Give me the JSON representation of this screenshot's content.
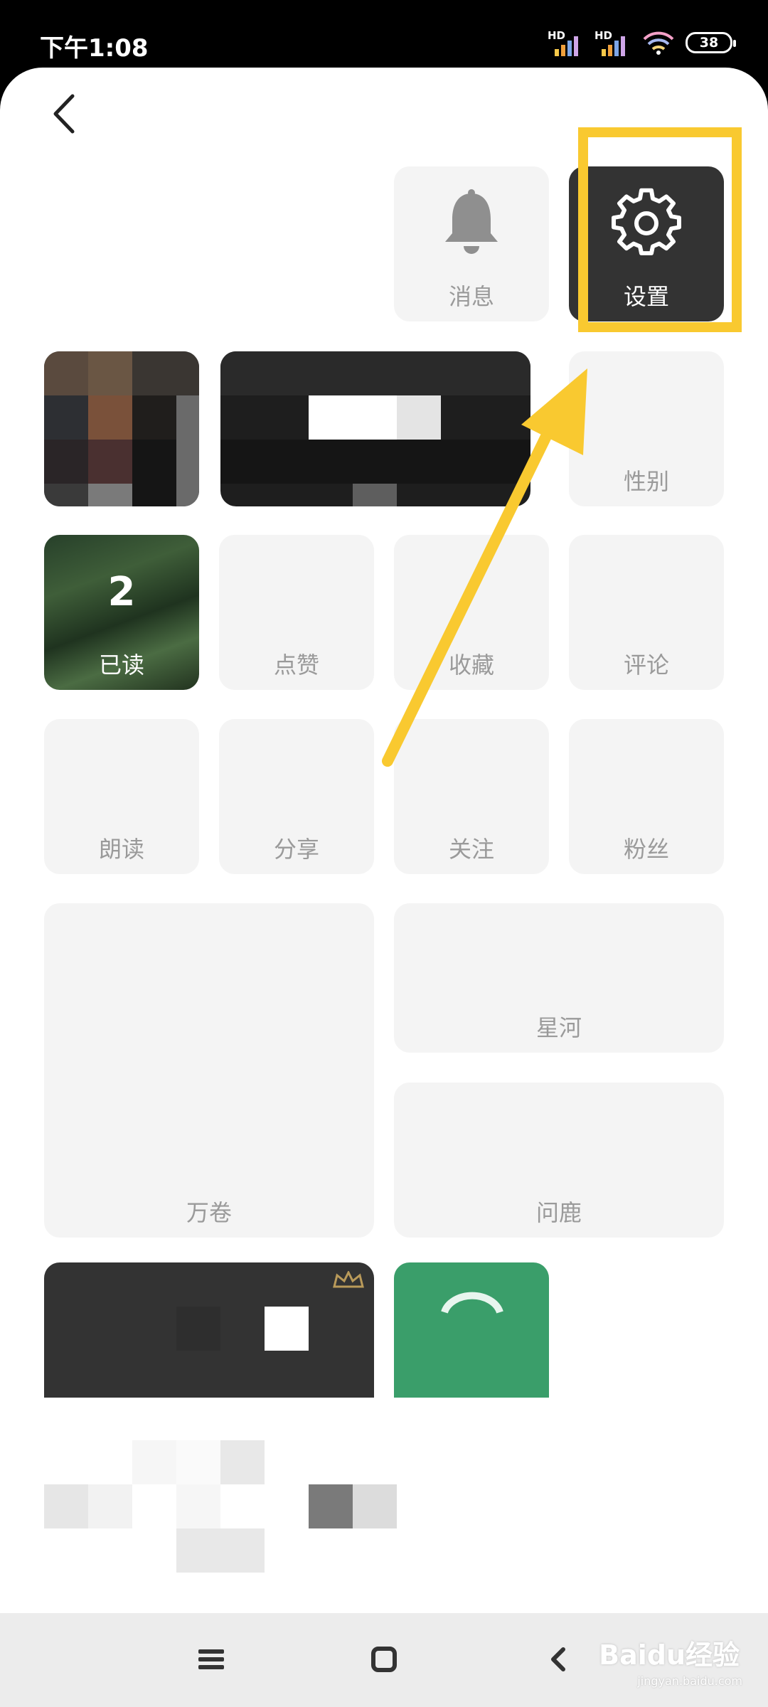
{
  "status_bar": {
    "time": "下午1:08",
    "sim1_label": "HD",
    "sim2_label": "HD",
    "battery": "38"
  },
  "tiles": {
    "messages": "消息",
    "settings": "设置",
    "gender": "性别",
    "read": "已读",
    "read_count": "2",
    "likes": "点赞",
    "favorites": "收藏",
    "comments": "评论",
    "read_aloud": "朗读",
    "share": "分享",
    "follow": "关注",
    "fans": "粉丝",
    "wanjuan": "万卷",
    "xinghe": "星河",
    "wenlu": "问鹿"
  },
  "watermark": {
    "brand": "Baidu经验",
    "url": "jingyan.baidu.com"
  },
  "colors": {
    "highlight": "#f9c930",
    "tile_bg": "#f4f4f4",
    "dark_tile": "#333333",
    "green_tile": "#3a9e6a"
  }
}
